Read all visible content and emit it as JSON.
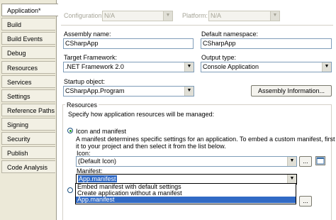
{
  "tabs": [
    {
      "label": "Application*",
      "active": true
    },
    {
      "label": "Build"
    },
    {
      "label": "Build Events"
    },
    {
      "label": "Debug"
    },
    {
      "label": "Resources"
    },
    {
      "label": "Services"
    },
    {
      "label": "Settings"
    },
    {
      "label": "Reference Paths"
    },
    {
      "label": "Signing"
    },
    {
      "label": "Security"
    },
    {
      "label": "Publish"
    },
    {
      "label": "Code Analysis"
    }
  ],
  "config": {
    "configuration_label": "Configuration:",
    "configuration_value": "N/A",
    "platform_label": "Platform:",
    "platform_value": "N/A"
  },
  "assembly": {
    "name_label": "Assembly name:",
    "name_value": "CSharpApp",
    "namespace_label": "Default namespace:",
    "namespace_value": "CSharpApp"
  },
  "target": {
    "framework_label": "Target Framework:",
    "framework_value": ".NET Framework 2.0",
    "output_label": "Output type:",
    "output_value": "Console Application"
  },
  "startup": {
    "label": "Startup object:",
    "value": "CSharpApp.Program",
    "assembly_info_button": "Assembly Information..."
  },
  "resources": {
    "group_label": "Resources",
    "description": "Specify how application resources will be managed:",
    "icon_manifest_radio": "Icon and manifest",
    "icon_manifest_desc1": "A manifest determines specific settings for an application. To embed a custom manifest, first add",
    "icon_manifest_desc2": "it to your project and then select it from the list below.",
    "icon_label": "Icon:",
    "icon_value": "(Default Icon)",
    "browse_button": "...",
    "manifest_label": "Manifest:",
    "manifest_value": "App.manifest",
    "manifest_options": [
      "Embed manifest with default settings",
      "Create application without a manifest",
      "App.manifest"
    ],
    "browse_button2": "..."
  },
  "colors": {
    "selection": "#316ac5",
    "window_bg": "#ece9d8",
    "field_border": "#7f9db9"
  }
}
